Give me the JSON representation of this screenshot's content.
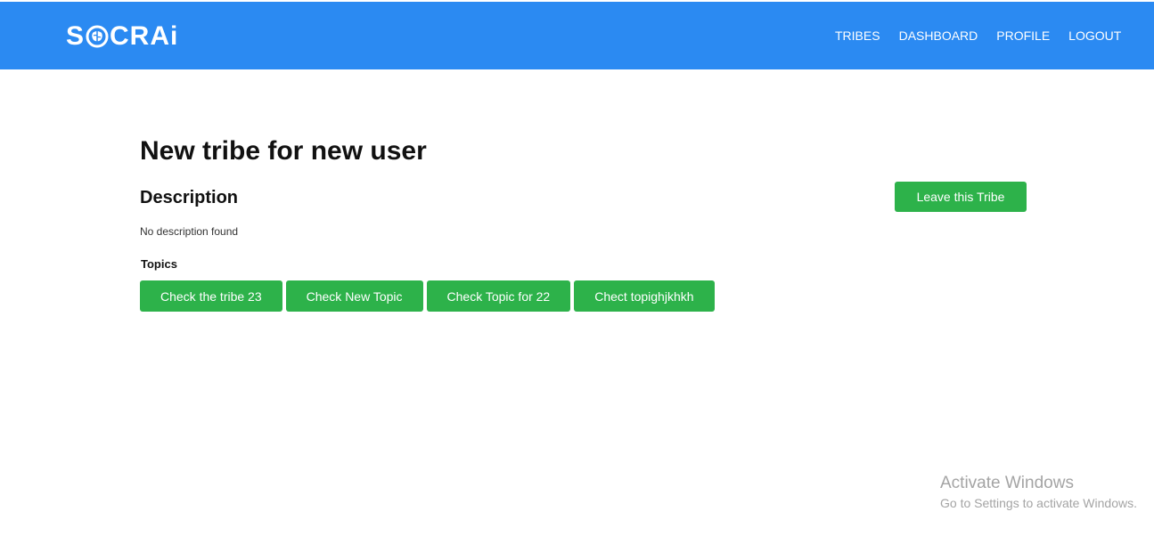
{
  "header": {
    "logo": {
      "text_start": "S",
      "text_mid": "CR",
      "text_accent": "Ai"
    },
    "nav": [
      {
        "label": "TRIBES"
      },
      {
        "label": "DASHBOARD"
      },
      {
        "label": "PROFILE"
      },
      {
        "label": "LOGOUT"
      }
    ]
  },
  "tribe": {
    "title": "New tribe for new user",
    "description_heading": "Description",
    "description_text": "No description found",
    "topics_heading": "Topics",
    "topics": [
      {
        "label": "Check the tribe 23"
      },
      {
        "label": "Check New Topic"
      },
      {
        "label": "Check Topic for 22"
      },
      {
        "label": "Chect topighjkhkh"
      }
    ],
    "leave_button": "Leave this Tribe"
  },
  "watermark": {
    "title": "Activate Windows",
    "subtitle": "Go to Settings to activate Windows."
  },
  "colors": {
    "navbar": "#2b8af2",
    "button": "#2db24a",
    "logo_accent": "#2fd07a"
  }
}
